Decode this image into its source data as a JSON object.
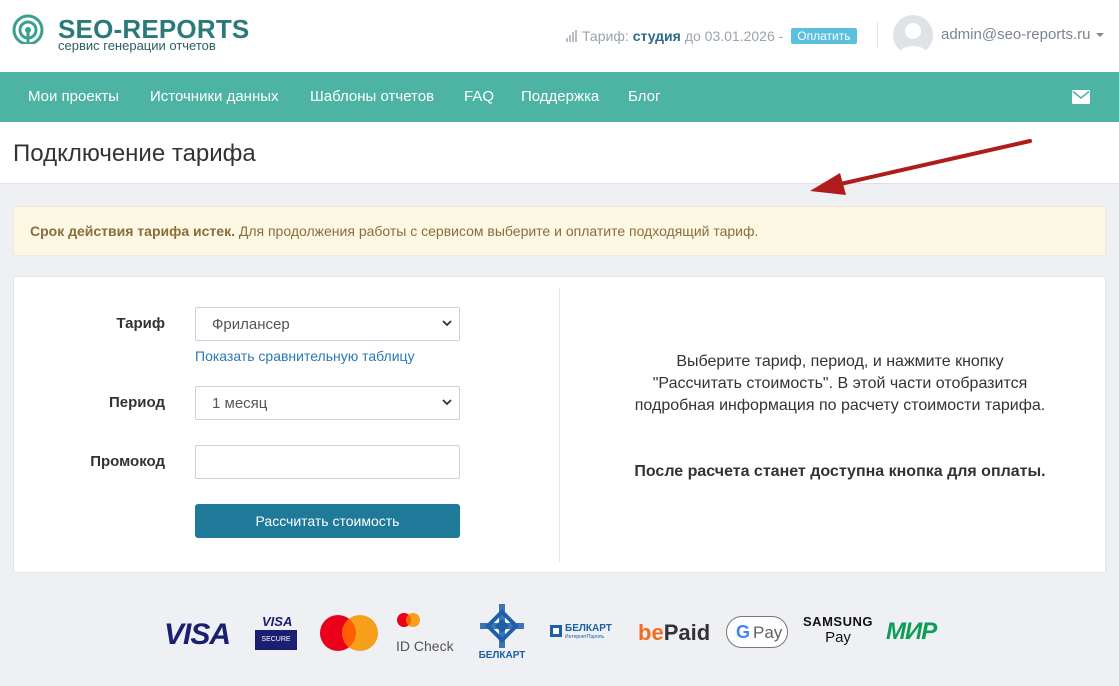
{
  "header": {
    "logo_name": "SEO-REPORTS",
    "logo_tagline": "сервис генерации отчетов",
    "plan_prefix": "Тариф:",
    "plan_name": "студия",
    "plan_until": "до 03.01.2026 -",
    "pay_badge": "Оплатить",
    "user_email": "admin@seo-reports.ru"
  },
  "nav": {
    "items": [
      "Мои проекты",
      "Источники данных",
      "Шаблоны отчетов",
      "FAQ",
      "Поддержка",
      "Блог"
    ],
    "mail_icon": "envelope-icon"
  },
  "page": {
    "title": "Подключение тарифа"
  },
  "alert": {
    "bold": "Срок действия тарифа истек.",
    "text": " Для продолжения работы с сервисом выберите и оплатите подходящий тариф."
  },
  "form": {
    "tariff_label": "Тариф",
    "tariff_value": "Фрилансер",
    "compare_link": "Показать сравнительную таблицу",
    "period_label": "Период",
    "period_value": "1 месяц",
    "promo_label": "Промокод",
    "promo_value": "",
    "calc_button": "Рассчитать стоимость"
  },
  "info": {
    "text": "Выберите тариф, период, и нажмите кнопку \"Рассчитать стоимость\". В этой части отобразится подробная информация по расчету стоимости тарифа.",
    "note": "После расчета станет доступна кнопка для оплаты."
  },
  "payments": {
    "visa": "VISA",
    "visa_secure_top": "VISA",
    "visa_secure_bottom": "SECURE",
    "id_check": "ID Check",
    "belkart": "БЕЛКАРТ",
    "belkart_top": "БЕЛКАРТ",
    "belkart_sub": "ИнтернетПароль",
    "bepaid_be": "be",
    "bepaid_paid": "Paid",
    "gpay": "Pay",
    "gpay_g": "G",
    "samsung_top": "SAMSUNG",
    "samsung_bottom": "Pay",
    "mir": "МИР"
  },
  "colors": {
    "accent": "#4db3a2",
    "button": "#1f7a9a",
    "alert_bg": "#fcf8e3",
    "arrow": "#b01c1c"
  }
}
